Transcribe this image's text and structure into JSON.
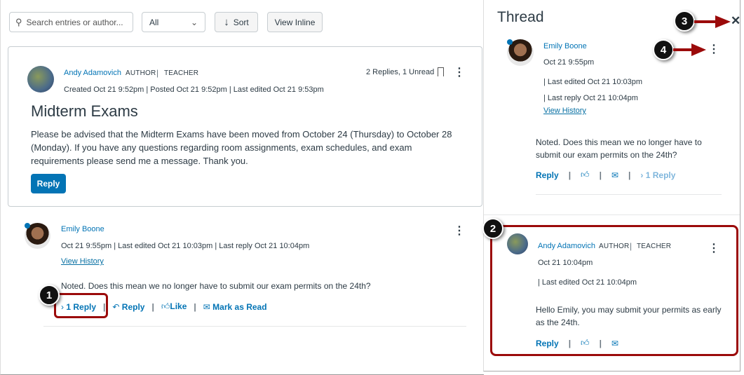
{
  "toolbar": {
    "search_placeholder": "Search entries or author...",
    "filter_value": "All",
    "sort_label": "Sort",
    "view_inline_label": "View Inline"
  },
  "topic": {
    "author": "Andy Adamovich",
    "role1": "AUTHOR",
    "role2": "TEACHER",
    "meta": "Created Oct 21 9:52pm | Posted Oct 21 9:52pm | Last edited Oct 21 9:53pm",
    "counts": "2 Replies, 1 Unread",
    "title": "Midterm Exams",
    "body": "Please be advised that the Midterm Exams have been moved from October 24 (Thursday) to October 28 (Monday). If you have any questions regarding room assignments, exam schedules, and exam requirements please send me a message. Thank you.",
    "reply_label": "Reply"
  },
  "entry": {
    "author": "Emily Boone",
    "meta": "Oct 21 9:55pm | Last edited Oct 21 10:03pm | Last reply Oct 21 10:04pm",
    "view_history": "View History",
    "body": "Noted. Does this mean we no longer have to submit our exam permits on the 24th?",
    "replies_label": "1 Reply",
    "reply_label": "Reply",
    "like_label": "Like",
    "mark_read_label": "Mark as Read"
  },
  "thread": {
    "title": "Thread",
    "parent": {
      "author": "Emily Boone",
      "date": "Oct 21 9:55pm",
      "last_edited": "| Last edited Oct 21 10:03pm",
      "last_reply": "| Last reply Oct 21 10:04pm",
      "view_history": "View History",
      "body": "Noted. Does this mean we no longer have to submit our exam permits on the 24th?",
      "reply_label": "Reply",
      "replies_label": "1 Reply"
    },
    "reply": {
      "author": "Andy Adamovich",
      "role1": "AUTHOR",
      "role2": "TEACHER",
      "date": "Oct 21 10:04pm",
      "last_edited": "| Last edited Oct 21 10:04pm",
      "body": "Hello Emily, you may submit your permits as early as the 24th.",
      "reply_label": "Reply"
    }
  },
  "callouts": [
    "1",
    "2",
    "3",
    "4"
  ],
  "colors": {
    "link": "#0374b5",
    "callout_red": "#9b0a0a"
  }
}
